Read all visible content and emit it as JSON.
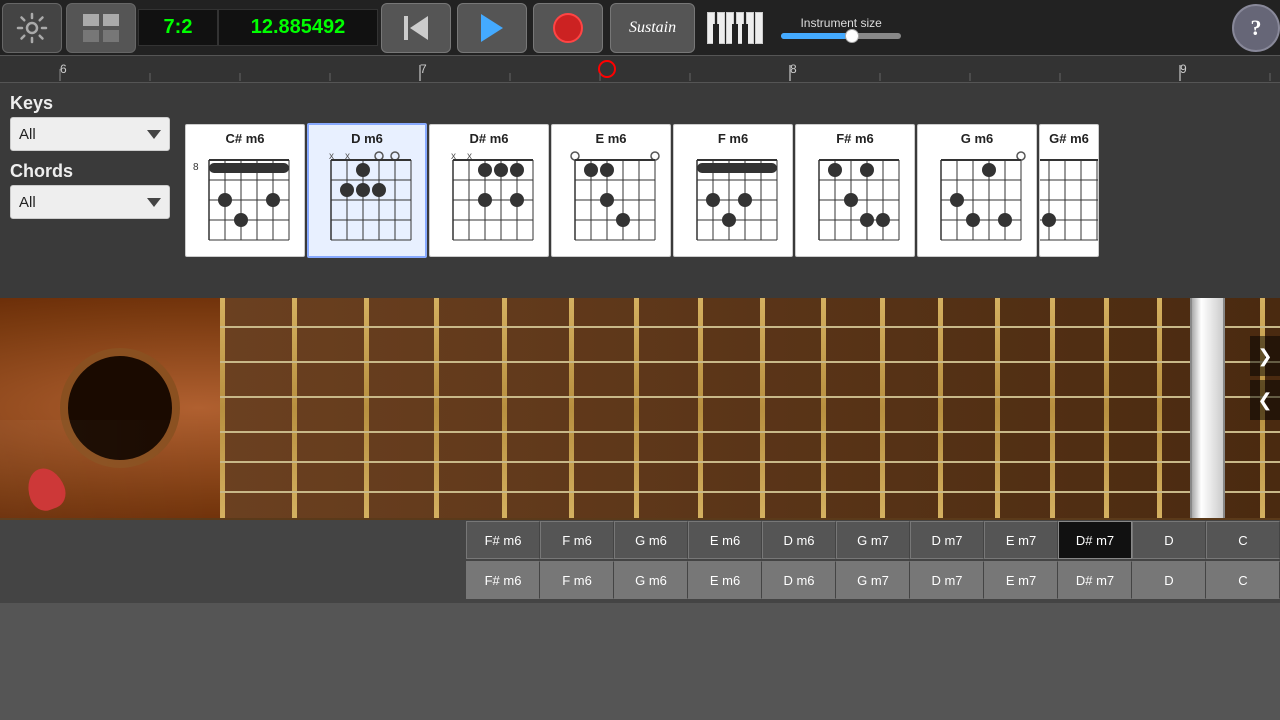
{
  "toolbar": {
    "time_signature": "7:2",
    "time_code": "12.885492",
    "sustain_label": "Sustain",
    "instrument_size_label": "Instrument size",
    "help_label": "?"
  },
  "timeline": {
    "markers": [
      "6",
      "7",
      "8",
      "9"
    ]
  },
  "keys_panel": {
    "label": "Keys",
    "dropdown_value": "All"
  },
  "chords_panel": {
    "label": "Chords",
    "dropdown_value": "All"
  },
  "chords": [
    {
      "name": "C# m6",
      "highlighted": false
    },
    {
      "name": "D m6",
      "highlighted": true
    },
    {
      "name": "D# m6",
      "highlighted": false
    },
    {
      "name": "E m6",
      "highlighted": false
    },
    {
      "name": "F m6",
      "highlighted": false
    },
    {
      "name": "F# m6",
      "highlighted": false
    },
    {
      "name": "G m6",
      "highlighted": false
    },
    {
      "name": "G# m6",
      "highlighted": false
    }
  ],
  "bottom_row1": [
    {
      "label": "F# m6",
      "active": false
    },
    {
      "label": "F m6",
      "active": false
    },
    {
      "label": "G m6",
      "active": false
    },
    {
      "label": "E m6",
      "active": false
    },
    {
      "label": "D m6",
      "active": false
    },
    {
      "label": "G m7",
      "active": false
    },
    {
      "label": "D m7",
      "active": false
    },
    {
      "label": "E m7",
      "active": false
    },
    {
      "label": "D# m7",
      "active": true
    },
    {
      "label": "D",
      "active": false
    },
    {
      "label": "C",
      "active": false
    }
  ],
  "bottom_row2": [
    {
      "label": "F# m6",
      "active": false
    },
    {
      "label": "F m6",
      "active": false
    },
    {
      "label": "G m6",
      "active": false
    },
    {
      "label": "E m6",
      "active": false
    },
    {
      "label": "D m6",
      "active": false
    },
    {
      "label": "G m7",
      "active": false
    },
    {
      "label": "D m7",
      "active": false
    },
    {
      "label": "E m7",
      "active": false
    },
    {
      "label": "D# m7",
      "active": false
    },
    {
      "label": "D",
      "active": false
    },
    {
      "label": "C",
      "active": false
    }
  ]
}
